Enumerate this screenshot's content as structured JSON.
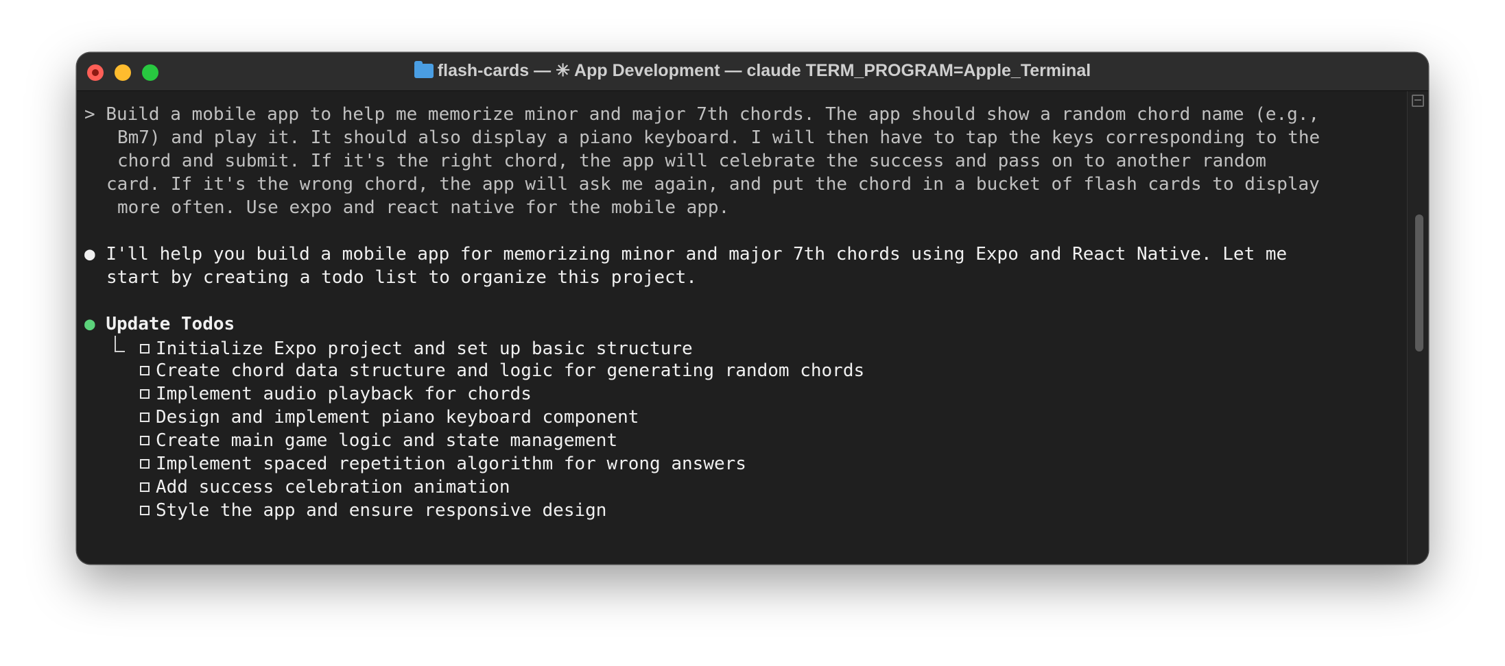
{
  "window": {
    "title": "flash-cards — ✳ App Development — claude TERM_PROGRAM=Apple_Terminal"
  },
  "prompt": {
    "symbol": ">",
    "lines": [
      "Build a mobile app to help me memorize minor and major 7th chords. The app should show a random chord name (e.g.,",
      "Bm7) and play it. It should also display a piano keyboard. I will then have to tap the keys corresponding to the",
      "chord and submit. If it's the right chord, the app will celebrate the success and pass on to another random",
      "card. If it's the wrong chord, the app will ask me again, and put the chord in a bucket of flash cards to display",
      "more often. Use expo and react native for the mobile app."
    ]
  },
  "response": {
    "bullet": "●",
    "lines": [
      "I'll help you build a mobile app for memorizing minor and major 7th chords using Expo and React Native. Let me",
      "start by creating a todo list to organize this project."
    ]
  },
  "todos": {
    "bullet": "●",
    "heading": "Update Todos",
    "items": [
      "Initialize Expo project and set up basic structure",
      "Create chord data structure and logic for generating random chords",
      "Implement audio playback for chords",
      "Design and implement piano keyboard component",
      "Create main game logic and state management",
      "Implement spaced repetition algorithm for wrong answers",
      "Add success celebration animation",
      "Style the app and ensure responsive design"
    ]
  },
  "colors": {
    "background": "#1f1f1f",
    "titlebar": "#2d2d2d",
    "status_green": "#5cd37b",
    "close": "#fe5f57",
    "minimize": "#febc2e",
    "maximize": "#28c840"
  }
}
